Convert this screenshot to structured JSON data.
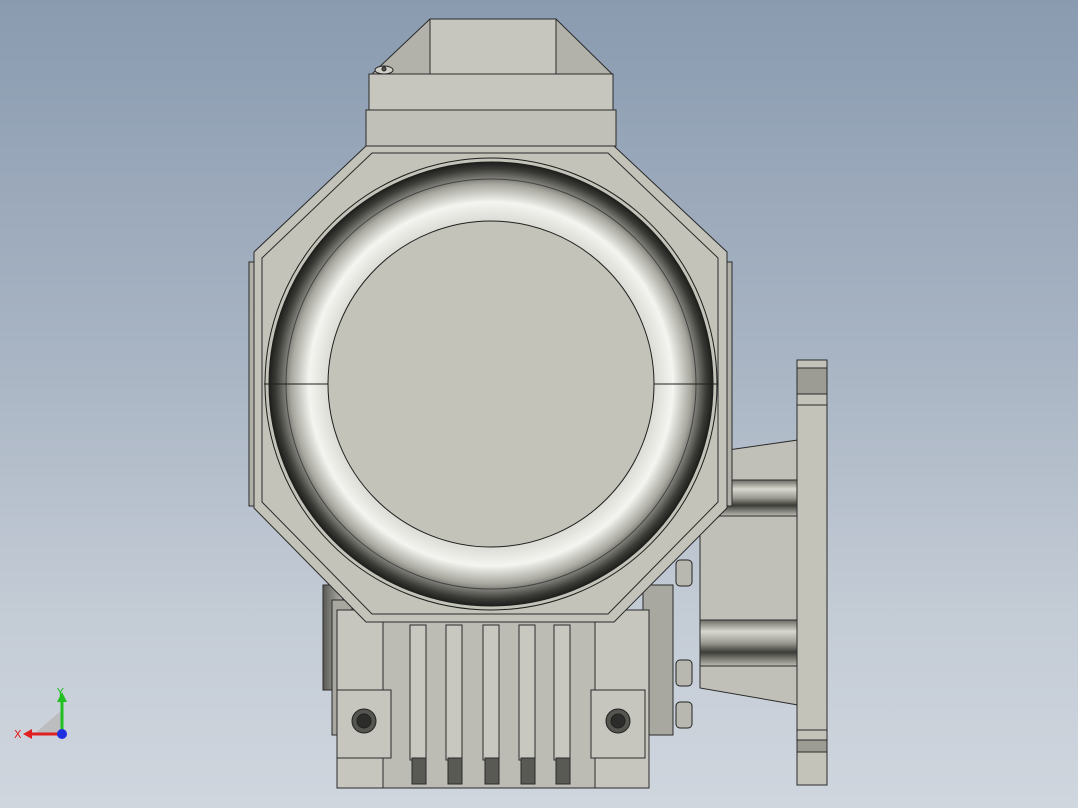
{
  "viewport": {
    "background_top": "#8a9bb0",
    "background_bottom": "#d0d6de",
    "model_fill": "#c3c3ba",
    "edge_color": "#2a2a2a"
  },
  "triad": {
    "x_label": "X",
    "y_label": "Y",
    "x_color": "#e02020",
    "y_color": "#20c020",
    "z_color": "#2030e0"
  }
}
